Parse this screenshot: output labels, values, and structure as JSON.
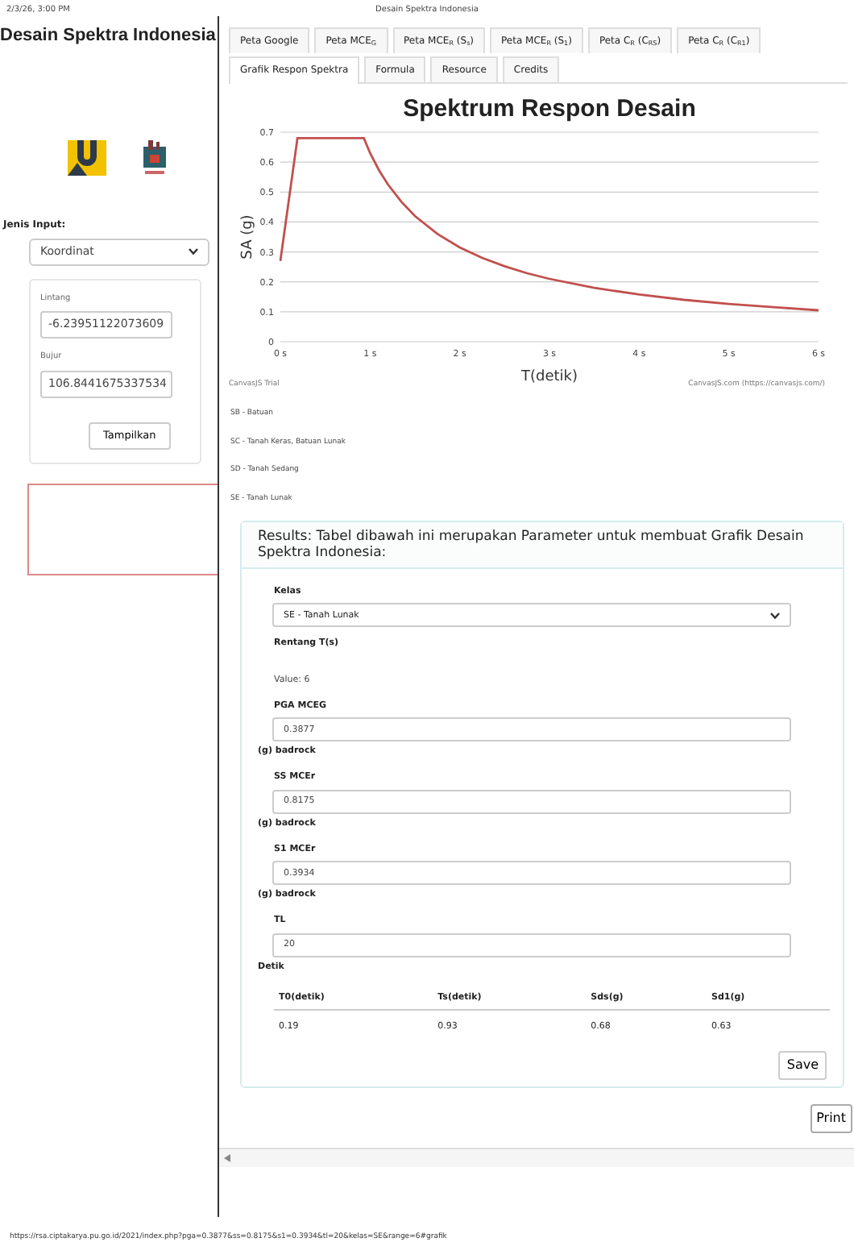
{
  "print_header": {
    "date": "2/3/26, 3:00 PM",
    "title": "Desain Spektra Indonesia"
  },
  "sidebar": {
    "title": "Desain Spektra Indonesia",
    "input_label": "Jenis Input:",
    "input_type": "Koordinat",
    "fields": [
      {
        "label": "Lintang",
        "value": "-6.23951122073609"
      },
      {
        "label": "Bujur",
        "value": "106.8441675337534"
      }
    ],
    "button": "Tampilkan"
  },
  "tabs": [
    {
      "label": "Peta Google",
      "selected": false
    },
    {
      "label": "Peta MCE$_{G}$",
      "selected": false
    },
    {
      "label": "Peta MCE$_{R}$ (S$_{s}$)",
      "selected": false
    },
    {
      "label": "Peta MCE$_{R}$ (S$_{1}$)",
      "selected": false
    },
    {
      "label": "Peta C$_{R}$ (C$_{RS}$)",
      "selected": false
    },
    {
      "label": "Peta C$_{R}$ (C$_{R1}$)",
      "selected": false
    },
    {
      "label": "Grafik Respon Spektra",
      "selected": true
    },
    {
      "label": "Formula",
      "selected": false
    },
    {
      "label": "Resource",
      "selected": false
    },
    {
      "label": "Credits",
      "selected": false
    }
  ],
  "chart": {
    "chart_data": {
      "type": "line",
      "title": "Spektrum Respon Desain",
      "xlabel": "T(detik)",
      "ylabel": "SA (g)",
      "x": [
        0,
        0.19,
        0.93,
        1,
        1.1,
        1.2,
        1.35,
        1.5,
        1.75,
        2,
        2.25,
        2.5,
        2.75,
        3,
        3.5,
        4,
        4.5,
        5,
        5.5,
        6
      ],
      "series": [
        {
          "color": "#c0504d",
          "values": [
            0.27,
            0.68,
            0.68,
            0.63,
            0.573,
            0.525,
            0.467,
            0.42,
            0.36,
            0.315,
            0.28,
            0.252,
            0.229,
            0.21,
            0.18,
            0.158,
            0.14,
            0.126,
            0.115,
            0.105
          ]
        }
      ],
      "grid": true,
      "xlim": [
        0,
        6
      ],
      "ylim": [
        0,
        0.7
      ],
      "xticks": [
        {
          "value": 0,
          "label": "0 s"
        },
        {
          "value": 1,
          "label": "1 s"
        },
        {
          "value": 2,
          "label": "2 s"
        },
        {
          "value": 3,
          "label": "3 s"
        },
        {
          "value": 4,
          "label": "4 s"
        },
        {
          "value": 5,
          "label": "5 s"
        },
        {
          "value": 6,
          "label": "6 s"
        }
      ],
      "yticks": [
        0,
        0.1,
        0.2,
        0.3,
        0.4,
        0.5,
        0.6,
        0.7
      ]
    },
    "credit_left": "CanvasJS Trial",
    "credit_right": "CanvasJS.com (https://canvasjs.com/)"
  },
  "soil_classes": [
    "SB - Batuan",
    "SC - Tanah Keras, Batuan Lunak",
    "SD - Tanah Sedang",
    "SE - Tanah Lunak"
  ],
  "results": {
    "header": "Results: Tabel dibawah ini merupakan Parameter untuk membuat Grafik Desain Spektra Indonesia:",
    "kelas_label": "Kelas",
    "kelas_value": "SE - Tanah Lunak",
    "range_label": "Rentang T(s)",
    "range_value": "Value: 6",
    "params": [
      {
        "label": "PGA MCEG",
        "value": "0.3877",
        "unit": "(g) badrock"
      },
      {
        "label": "SS MCEr",
        "value": "0.8175",
        "unit": "(g) badrock"
      },
      {
        "label": "S1 MCEr",
        "value": "0.3934",
        "unit": "(g) badrock"
      },
      {
        "label": "TL",
        "value": "20",
        "unit": "Detik"
      }
    ],
    "table": {
      "columns": [
        "T0(detik)",
        "Ts(detik)",
        "Sds(g)",
        "Sd1(g)"
      ],
      "rows": [
        [
          "0.19",
          "0.93",
          "0.68",
          "0.63"
        ]
      ]
    },
    "save": "Save"
  },
  "print": "Print",
  "footer_url": "https://rsa.ciptakarya.pu.go.id/2021/index.php?pga=0.3877&ss=0.8175&s1=0.3934&tl=20&kelas=SE&range=6#grafik"
}
